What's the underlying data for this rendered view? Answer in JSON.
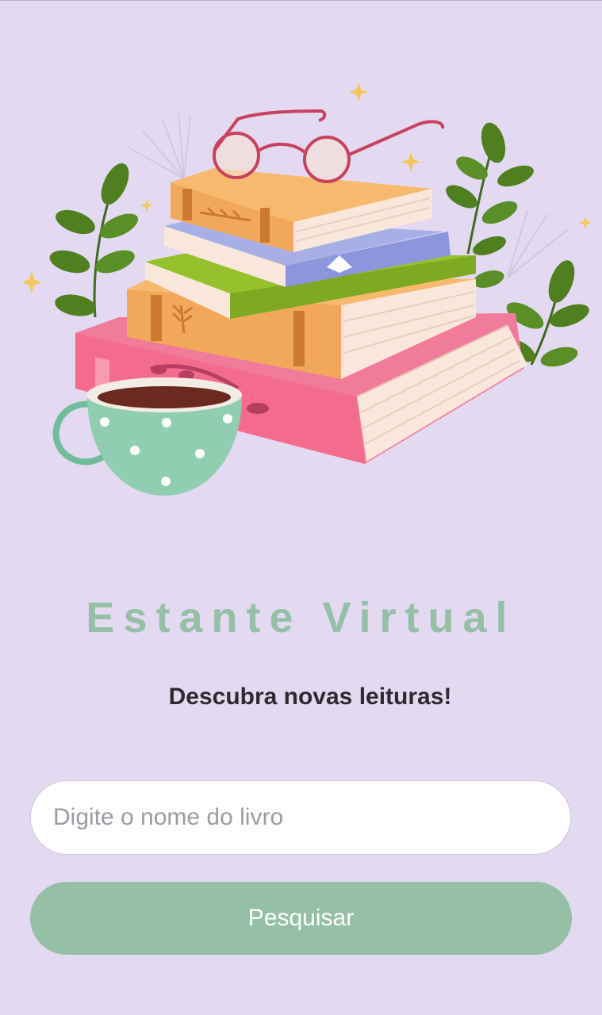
{
  "app": {
    "title": "Estante Virtual",
    "subtitle": "Descubra novas leituras!"
  },
  "search": {
    "placeholder": "Digite o nome do livro",
    "value": "",
    "button_label": "Pesquisar"
  },
  "colors": {
    "background": "#e3d9f1",
    "accent": "#95c0a6",
    "subtitle": "#2d2a30"
  },
  "illustration": {
    "subject": "stack-of-books-with-glasses-and-teacup"
  }
}
